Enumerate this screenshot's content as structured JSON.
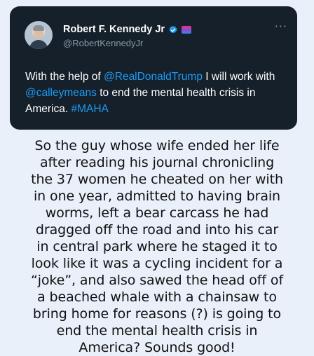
{
  "tweet": {
    "display_name": "Robert F. Kennedy Jr",
    "handle": "@RobertKennedyJr",
    "more_label": "···",
    "text_parts": {
      "t1": "With the help of ",
      "m1": "@RealDonaldTrump",
      "t2": " I will work with ",
      "m2": "@calleymeans",
      "t3": " to end the mental health crisis in America. ",
      "h1": "#MAHA"
    }
  },
  "caption": {
    "line1": "So the guy whose wife ended her life",
    "line2": "after reading his journal chronicling",
    "line3": "the 37 women he cheated on her with",
    "line4": "in one year, admitted to having brain",
    "line5": "worms, left a bear carcass he had",
    "line6": "dragged off the road and into his car",
    "line7": "in central park where he staged it to",
    "line8": "look like it was a cycling incident for a",
    "line9": "“joke”, and also sawed the head off of",
    "line10": "a beached whale with a chainsaw to",
    "line11": "bring home for reasons (?) is going to",
    "line12": "end the mental health crisis in",
    "line13": "America? Sounds good!"
  },
  "colors": {
    "page_background": "#e9f0fa",
    "card_background": "#15202b",
    "link": "#1d9bf0",
    "secondary_text": "#8b98a5"
  },
  "icons": {
    "verified": "verified-badge-icon",
    "flag": "flag-icon",
    "more": "more-options-icon"
  }
}
